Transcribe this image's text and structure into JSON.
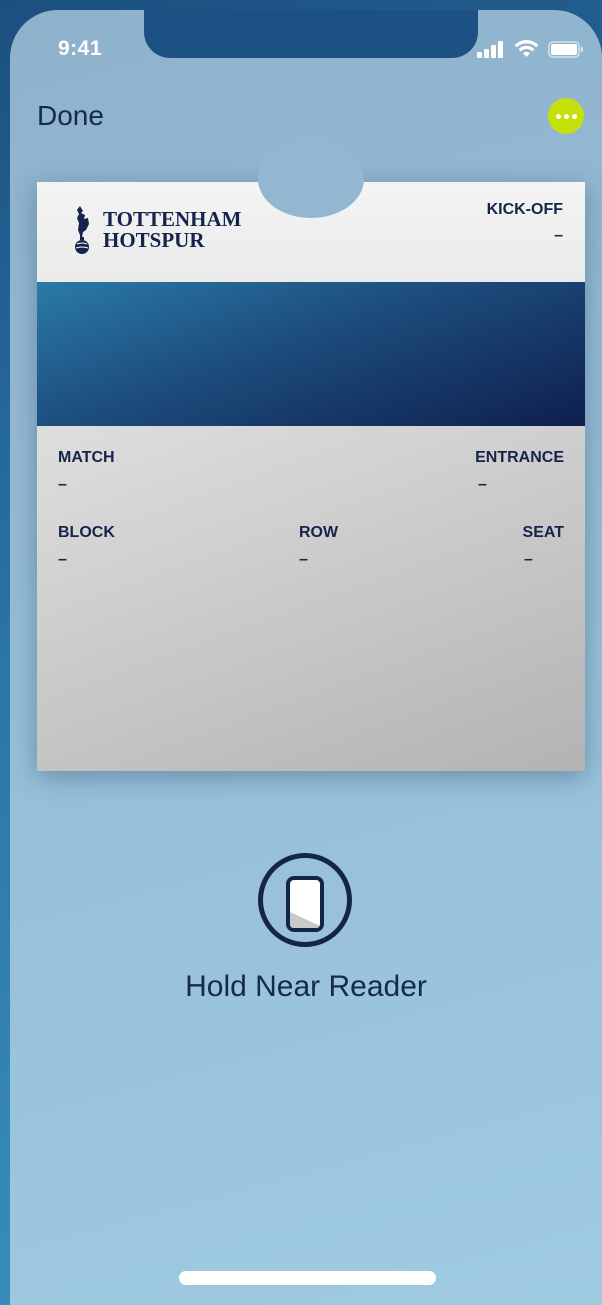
{
  "status_bar": {
    "time": "9:41"
  },
  "nav": {
    "done_label": "Done",
    "more_icon": "ellipsis-icon"
  },
  "pass": {
    "logo_line1": "TOTTENHAM",
    "logo_line2": "HOTSPUR",
    "kickoff_label": "KICK-OFF",
    "kickoff_value": "–",
    "match_label": "MATCH",
    "match_value": "–",
    "entrance_label": "ENTRANCE",
    "entrance_value": "–",
    "block_label": "BLOCK",
    "block_value": "–",
    "row_label": "ROW",
    "row_value": "–",
    "seat_label": "SEAT",
    "seat_value": "–"
  },
  "nfc": {
    "prompt": "Hold Near Reader",
    "icon": "phone-icon"
  },
  "colors": {
    "accent": "#c6e00c",
    "navy": "#14244a"
  }
}
